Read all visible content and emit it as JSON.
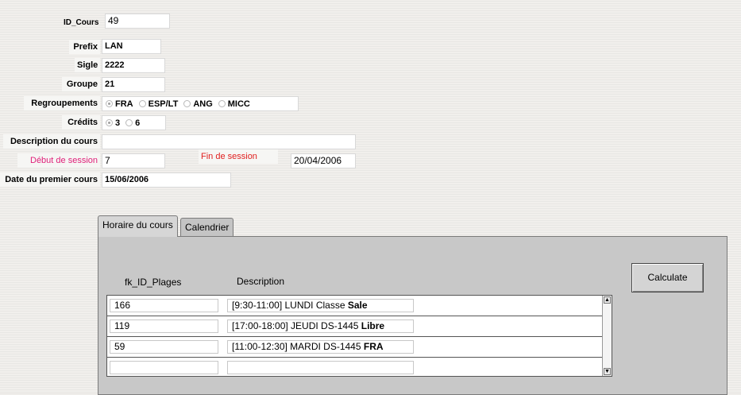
{
  "form": {
    "id_cours": {
      "label": "ID_Cours",
      "value": "49"
    },
    "prefix": {
      "label": "Prefix",
      "value": "LAN"
    },
    "sigle": {
      "label": "Sigle",
      "value": "2222"
    },
    "groupe": {
      "label": "Groupe",
      "value": "21"
    },
    "regroupements": {
      "label": "Regroupements",
      "options": [
        "FRA",
        "ESP/LT",
        "ANG",
        "MICC"
      ],
      "selected": "FRA"
    },
    "credits": {
      "label": "Crédits",
      "options": [
        "3",
        "6"
      ],
      "selected": "3"
    },
    "description": {
      "label": "Description du cours",
      "value": ""
    },
    "debut_session": {
      "label": "Début de session",
      "value": "7"
    },
    "fin_session": {
      "label": "Fin de session",
      "value": "20/04/2006"
    },
    "date_premier_cours": {
      "label": "Date du premier cours",
      "value": "15/06/2006"
    }
  },
  "tabs": {
    "horaire": "Horaire du cours",
    "calendrier": "Calendrier",
    "active": "horaire"
  },
  "schedule": {
    "col_id": "fk_ID_Plages",
    "col_desc": "Description",
    "calculate_label": "Calculate",
    "rows": [
      {
        "id": "166",
        "desc": "[9:30-11:00] LUNDI Classe ",
        "desc_bold": "Sale"
      },
      {
        "id": "119",
        "desc": "[17:00-18:00] JEUDI DS-1445 ",
        "desc_bold": "Libre"
      },
      {
        "id": "59",
        "desc": "[11:00-12:30] MARDI DS-1445 ",
        "desc_bold": "FRA"
      },
      {
        "id": "",
        "desc": "",
        "desc_bold": ""
      }
    ]
  },
  "colors": {
    "label_highlight": "#e0207a",
    "fin_session": "#e02020",
    "panel_bg": "#c8c8c8"
  }
}
